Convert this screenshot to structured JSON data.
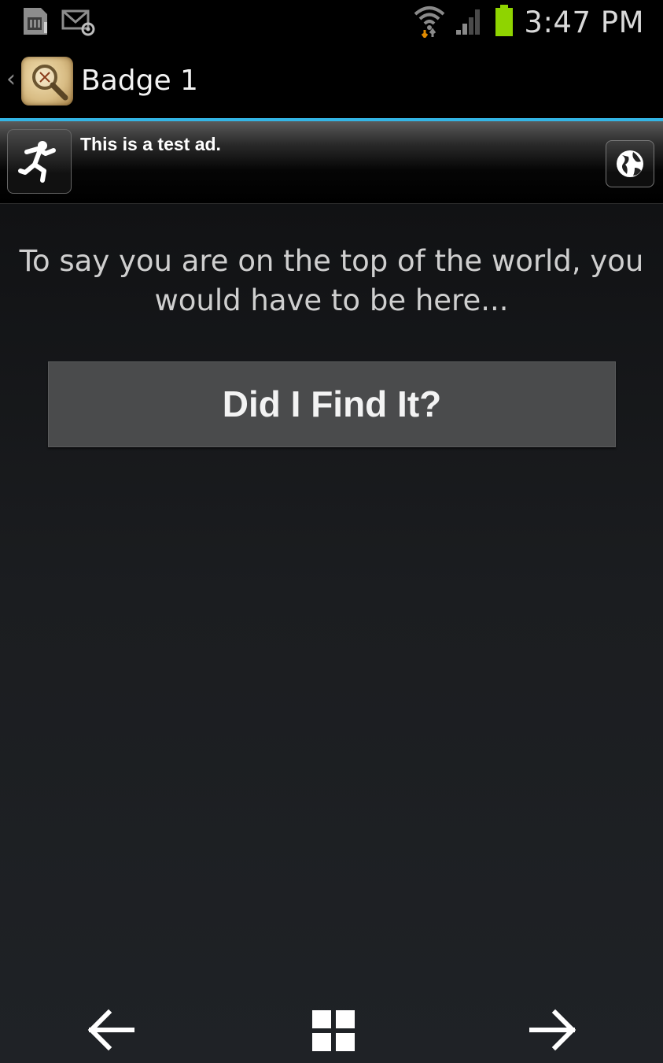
{
  "status_bar": {
    "icons_left": [
      "sim-card-icon",
      "email-notification-icon"
    ],
    "icons_right": [
      "wifi-icon",
      "signal-icon",
      "battery-icon"
    ],
    "time": "3:47 PM",
    "battery_color": "#8fd400"
  },
  "action_bar": {
    "up_indicator": "‹",
    "app_icon": "treasure-map-magnifier-icon",
    "title": "Badge 1",
    "accent_color": "#33b5e5"
  },
  "ad": {
    "icon": "running-man-icon",
    "text": "This is a test ad.",
    "action_icon": "globe-icon"
  },
  "main": {
    "clue_text": "To say you are on the top of the world, you would have to be here...",
    "find_button_label": "Did I Find It?"
  },
  "bottom_nav": {
    "items": [
      "back-arrow-icon",
      "grid-icon",
      "forward-arrow-icon"
    ]
  }
}
